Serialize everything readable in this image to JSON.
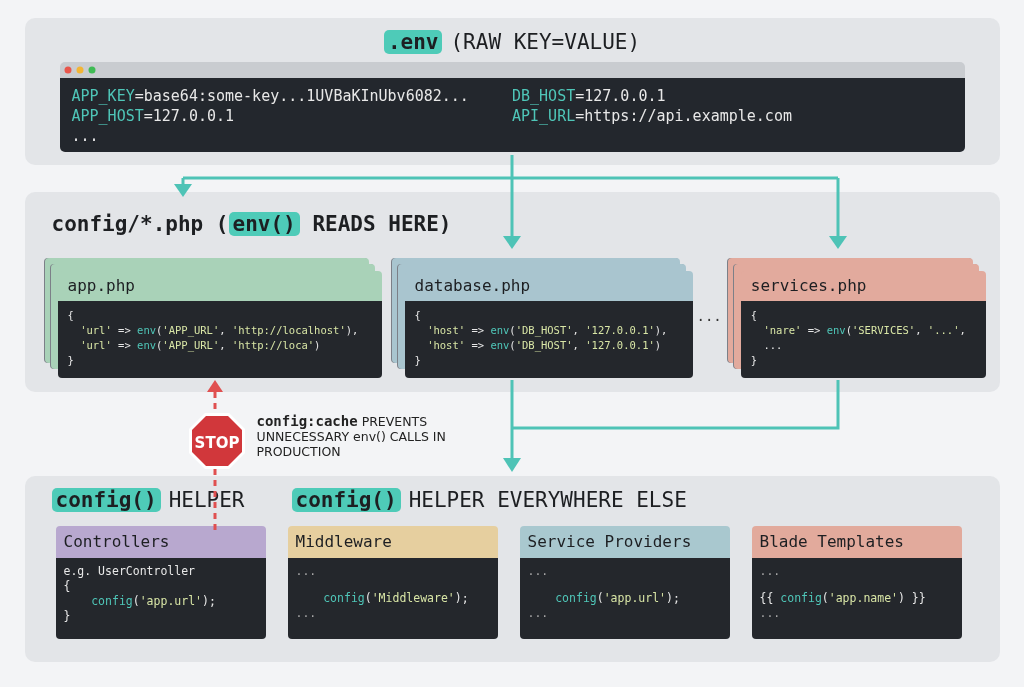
{
  "env_section": {
    "title": [
      {
        "text": ".env",
        "highlight": true
      },
      {
        "text": "(RAW KEY=VALUE)",
        "highlight": false
      }
    ],
    "terminal": {
      "columns": [
        [
          [
            {
              "text": "APP_KEY",
              "kind": "key"
            },
            {
              "text": "=base64:some-key...1UVBaKInUbv6082...",
              "kind": "plain"
            }
          ],
          [
            {
              "text": "APP_HOST",
              "kind": "key"
            },
            {
              "text": "=127.0.0.1",
              "kind": "plain"
            }
          ],
          [
            {
              "text": "...",
              "kind": "plain"
            }
          ]
        ],
        [
          [
            {
              "text": "DB_HOST",
              "kind": "key"
            },
            {
              "text": "=127.0.0.1",
              "kind": "plain"
            }
          ],
          [
            {
              "text": "API_URL",
              "kind": "key"
            },
            {
              "text": "=https://api.example.com",
              "kind": "plain"
            }
          ]
        ]
      ]
    }
  },
  "config_section": {
    "title": [
      {
        "text": "config/*.php (",
        "highlight": false
      },
      {
        "text": "env()",
        "highlight": true
      },
      {
        "text": " READS HERE)",
        "highlight": false
      }
    ],
    "files": [
      {
        "kind": "file",
        "name": "app.php",
        "color": "#a9d2b8",
        "lines": [
          [
            {
              "text": "{",
              "kind": "plain"
            }
          ],
          [
            {
              "text": "  'url'",
              "kind": "str"
            },
            {
              "text": " => ",
              "kind": "plain"
            },
            {
              "text": "env",
              "kind": "fn"
            },
            {
              "text": "(",
              "kind": "plain"
            },
            {
              "text": "'APP_URL'",
              "kind": "str"
            },
            {
              "text": ", ",
              "kind": "plain"
            },
            {
              "text": "'http://localhost'",
              "kind": "str"
            },
            {
              "text": "),",
              "kind": "plain"
            }
          ],
          [
            {
              "text": "  'url'",
              "kind": "str"
            },
            {
              "text": " => ",
              "kind": "plain"
            },
            {
              "text": "env",
              "kind": "fn"
            },
            {
              "text": "(",
              "kind": "plain"
            },
            {
              "text": "'APP_URL'",
              "kind": "str"
            },
            {
              "text": ", ",
              "kind": "plain"
            },
            {
              "text": "'http://loca'",
              "kind": "str"
            },
            {
              "text": ")",
              "kind": "plain"
            }
          ],
          [
            {
              "text": "}",
              "kind": "plain"
            }
          ]
        ]
      },
      {
        "kind": "file",
        "name": "database.php",
        "color": "#a9c5cf",
        "lines": [
          [
            {
              "text": "{",
              "kind": "plain"
            }
          ],
          [
            {
              "text": "  'host'",
              "kind": "str"
            },
            {
              "text": " => ",
              "kind": "plain"
            },
            {
              "text": "env",
              "kind": "fn"
            },
            {
              "text": "(",
              "kind": "plain"
            },
            {
              "text": "'DB_HOST'",
              "kind": "str"
            },
            {
              "text": ", ",
              "kind": "plain"
            },
            {
              "text": "'127.0.0.1'",
              "kind": "str"
            },
            {
              "text": "),",
              "kind": "plain"
            }
          ],
          [
            {
              "text": "  'host'",
              "kind": "str"
            },
            {
              "text": " => ",
              "kind": "plain"
            },
            {
              "text": "env",
              "kind": "fn"
            },
            {
              "text": "(",
              "kind": "plain"
            },
            {
              "text": "'DB_HOST'",
              "kind": "str"
            },
            {
              "text": ", ",
              "kind": "plain"
            },
            {
              "text": "'127.0.0.1'",
              "kind": "str"
            },
            {
              "text": ")",
              "kind": "plain"
            }
          ],
          [
            {
              "text": "}",
              "kind": "plain"
            }
          ]
        ]
      },
      {
        "kind": "ellipsis",
        "text": "..."
      },
      {
        "kind": "file",
        "name": "services.php",
        "color": "#e2aa9d",
        "lines": [
          [
            {
              "text": "{",
              "kind": "plain"
            }
          ],
          [
            {
              "text": "  'nare'",
              "kind": "str"
            },
            {
              "text": " => ",
              "kind": "plain"
            },
            {
              "text": "env",
              "kind": "fn"
            },
            {
              "text": "(",
              "kind": "plain"
            },
            {
              "text": "'SERVICES'",
              "kind": "str"
            },
            {
              "text": ", ",
              "kind": "plain"
            },
            {
              "text": "'...'",
              "kind": "str"
            },
            {
              "text": ",",
              "kind": "plain"
            }
          ],
          [
            {
              "text": "  ...",
              "kind": "plain"
            }
          ],
          [
            {
              "text": "}",
              "kind": "plain"
            }
          ]
        ]
      }
    ]
  },
  "note": {
    "sign": "STOP",
    "text": "**config:cache** PREVENTS UNNECESSARY env() CALLS IN PRODUCTION"
  },
  "helper_section": {
    "titles": [
      [
        {
          "text": "config()",
          "highlight": true
        },
        {
          "text": "HELPER",
          "highlight": false
        }
      ],
      [
        {
          "text": "config()",
          "highlight": true
        },
        {
          "text": "HELPER EVERYWHERE ELSE",
          "highlight": false
        }
      ]
    ],
    "cards": [
      {
        "name": "Controllers",
        "color": "#b8a8cf",
        "lines": [
          {
            "gap": false,
            "tokens": [
              {
                "text": "e.g. UserController",
                "kind": "plain"
              }
            ]
          },
          {
            "gap": false,
            "tokens": [
              {
                "text": "{",
                "kind": "plain"
              }
            ]
          },
          {
            "gap": false,
            "tokens": [
              {
                "text": "    config",
                "kind": "fn"
              },
              {
                "text": "(",
                "kind": "plain"
              },
              {
                "text": "'app.url'",
                "kind": "str"
              },
              {
                "text": ");",
                "kind": "plain"
              }
            ]
          },
          {
            "gap": false,
            "tokens": [
              {
                "text": "}",
                "kind": "plain"
              }
            ]
          }
        ]
      },
      {
        "name": "Middleware",
        "color": "#e6cf9f",
        "lines": [
          {
            "gap": false,
            "tokens": [
              {
                "text": "...",
                "kind": "dim"
              }
            ]
          },
          {
            "gap": true,
            "tokens": [
              {
                "text": "    config",
                "kind": "fn"
              },
              {
                "text": "(",
                "kind": "plain"
              },
              {
                "text": "'Middleware'",
                "kind": "str"
              },
              {
                "text": ");",
                "kind": "plain"
              }
            ]
          },
          {
            "gap": false,
            "tokens": [
              {
                "text": "...",
                "kind": "dim"
              }
            ]
          }
        ]
      },
      {
        "name": "Service Providers",
        "color": "#a9c8cf",
        "lines": [
          {
            "gap": false,
            "tokens": [
              {
                "text": "...",
                "kind": "dim"
              }
            ]
          },
          {
            "gap": true,
            "tokens": [
              {
                "text": "    config",
                "kind": "fn"
              },
              {
                "text": "(",
                "kind": "plain"
              },
              {
                "text": "'app.url'",
                "kind": "str"
              },
              {
                "text": ");",
                "kind": "plain"
              }
            ]
          },
          {
            "gap": false,
            "tokens": [
              {
                "text": "...",
                "kind": "dim"
              }
            ]
          }
        ]
      },
      {
        "name": "Blade Templates",
        "color": "#e2aa9c",
        "lines": [
          {
            "gap": false,
            "tokens": [
              {
                "text": "...",
                "kind": "dim"
              }
            ]
          },
          {
            "gap": true,
            "tokens": [
              {
                "text": "{{ ",
                "kind": "plain"
              },
              {
                "text": "config",
                "kind": "fn"
              },
              {
                "text": "(",
                "kind": "plain"
              },
              {
                "text": "'app.name'",
                "kind": "str"
              },
              {
                "text": ") }}",
                "kind": "plain"
              }
            ]
          },
          {
            "gap": false,
            "tokens": [
              {
                "text": "...",
                "kind": "dim"
              }
            ]
          }
        ]
      }
    ]
  }
}
